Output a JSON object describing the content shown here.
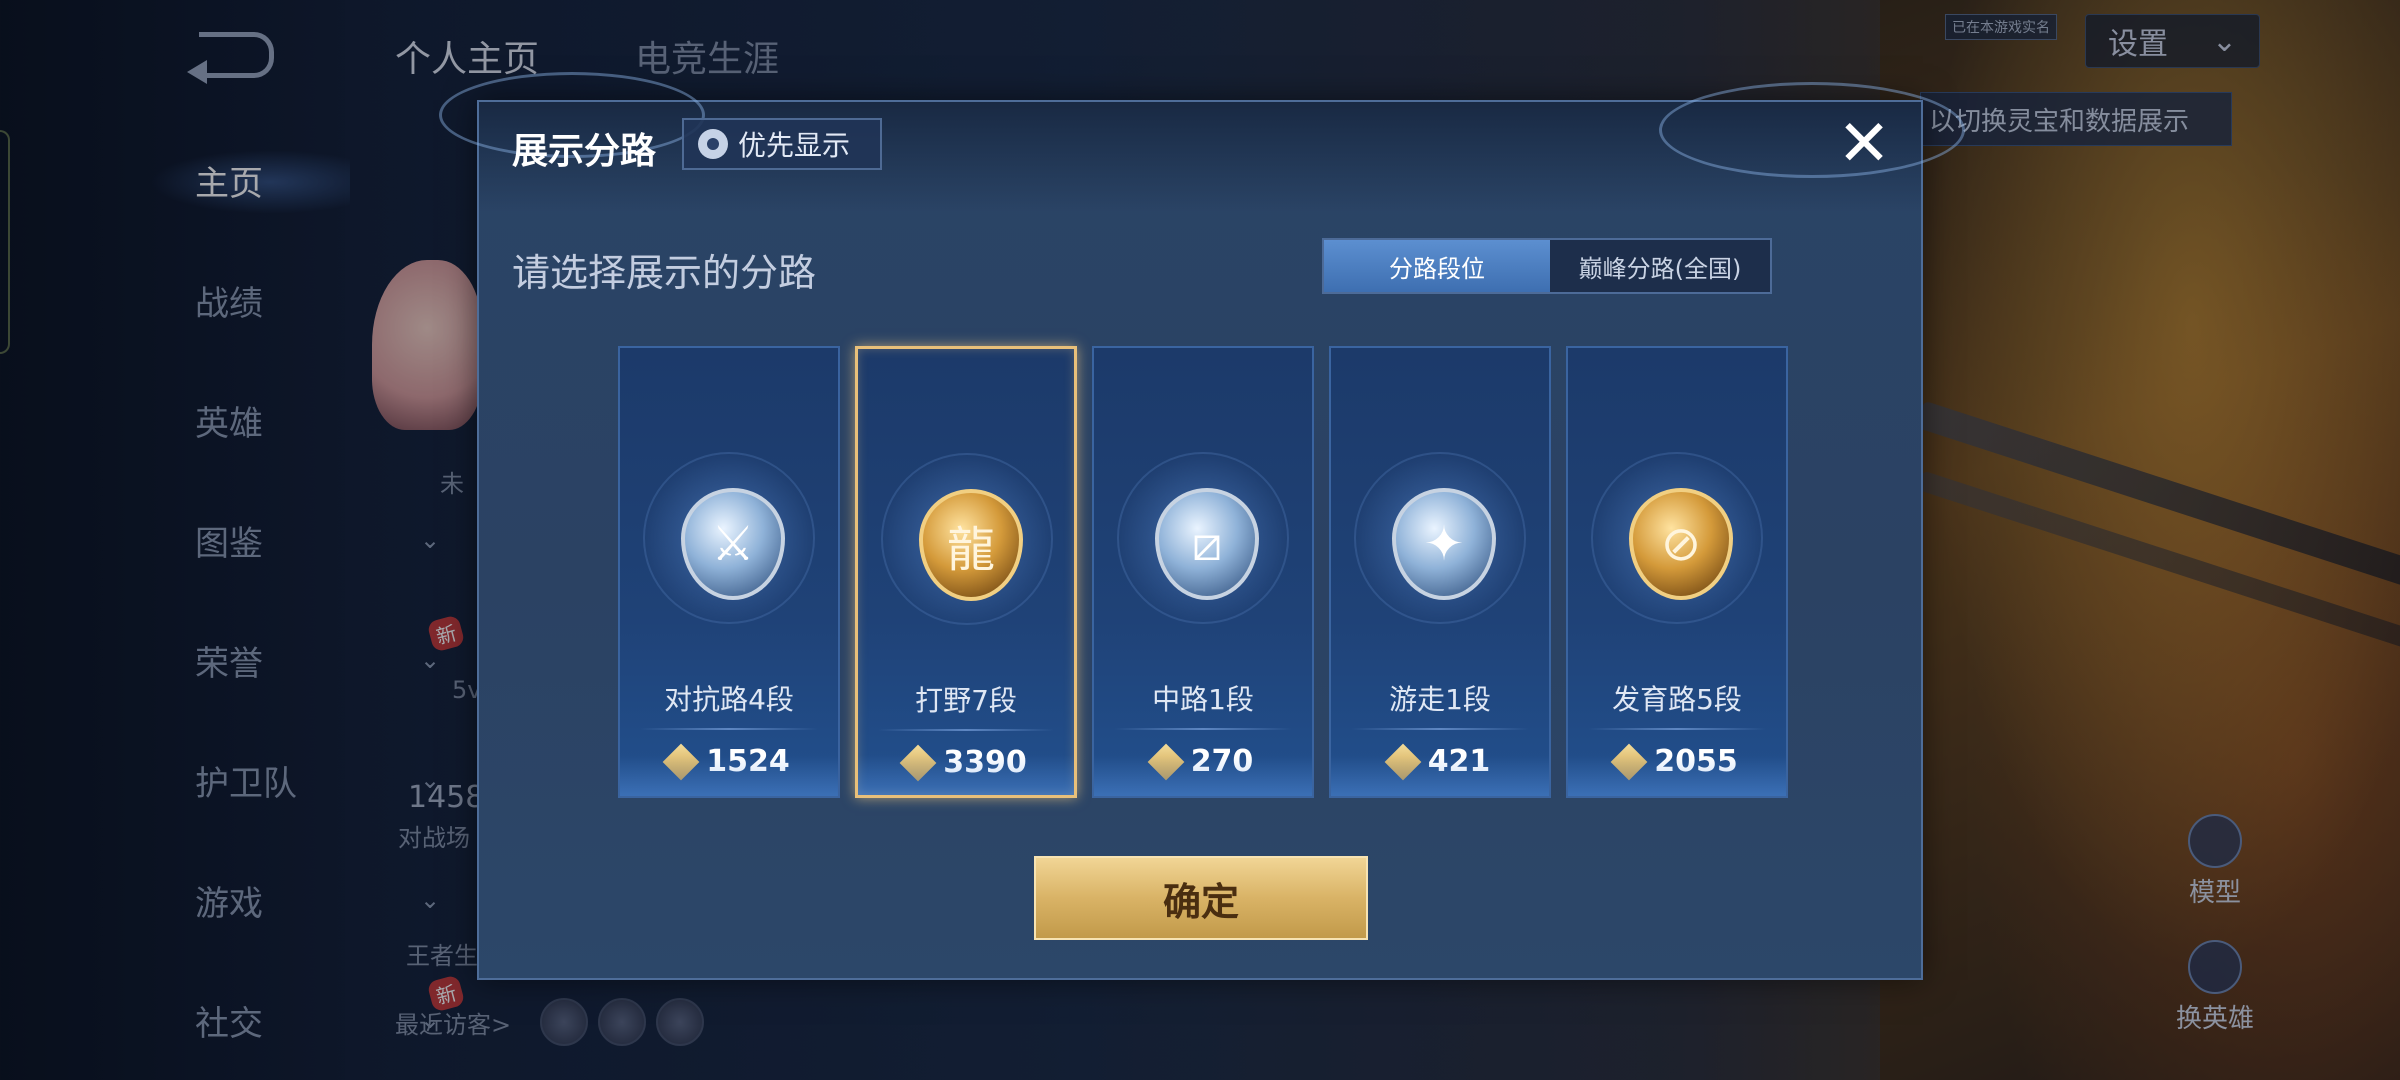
{
  "sidebar": {
    "items": [
      {
        "label": "主页",
        "active": true,
        "chevron": false,
        "new": false
      },
      {
        "label": "战绩",
        "active": false,
        "chevron": false,
        "new": false
      },
      {
        "label": "英雄",
        "active": false,
        "chevron": false,
        "new": false
      },
      {
        "label": "图鉴",
        "active": false,
        "chevron": true,
        "new": false
      },
      {
        "label": "荣誉",
        "active": false,
        "chevron": true,
        "new": true
      },
      {
        "label": "护卫队",
        "active": false,
        "chevron": true,
        "new": false
      },
      {
        "label": "游戏",
        "active": false,
        "chevron": true,
        "new": false
      },
      {
        "label": "社交",
        "active": false,
        "chevron": true,
        "new": true
      }
    ],
    "new_badge": "新"
  },
  "top_tabs": [
    "个人主页",
    "电竞生涯"
  ],
  "settings_label": "设置",
  "small_tag": "已在本游戏实名",
  "hint_text": "以切换灵宝和数据展示",
  "background_fragments": {
    "frag1": "未",
    "frag2": "5v",
    "frag3": "1458",
    "frag4": "对战场",
    "frag5": "王者生"
  },
  "recent_visitors": "最近访客>",
  "right_buttons": [
    "模型",
    "换英雄"
  ],
  "modal": {
    "title": "展示分路",
    "priority_label": "优先显示",
    "subtitle": "请选择展示的分路",
    "segment": [
      "分路段位",
      "巅峰分路(全国)"
    ],
    "segment_active": 0,
    "confirm_label": "确定",
    "close_icon": "close-icon"
  },
  "lanes": [
    {
      "name": "对抗路4段",
      "score": "1524",
      "style": "silver",
      "icon": "⚔",
      "selected": false
    },
    {
      "name": "打野7段",
      "score": "3390",
      "style": "gold",
      "icon": "龍",
      "selected": true
    },
    {
      "name": "中路1段",
      "score": "270",
      "style": "silver",
      "icon": "⧄",
      "selected": false
    },
    {
      "name": "游走1段",
      "score": "421",
      "style": "silver",
      "icon": "✦",
      "selected": false
    },
    {
      "name": "发育路5段",
      "score": "2055",
      "style": "gold",
      "icon": "⊘",
      "selected": false
    }
  ],
  "colors": {
    "gold_accent": "#e9c07a",
    "modal_bg": "#2a4466",
    "segment_active": "#4a7fc2"
  }
}
